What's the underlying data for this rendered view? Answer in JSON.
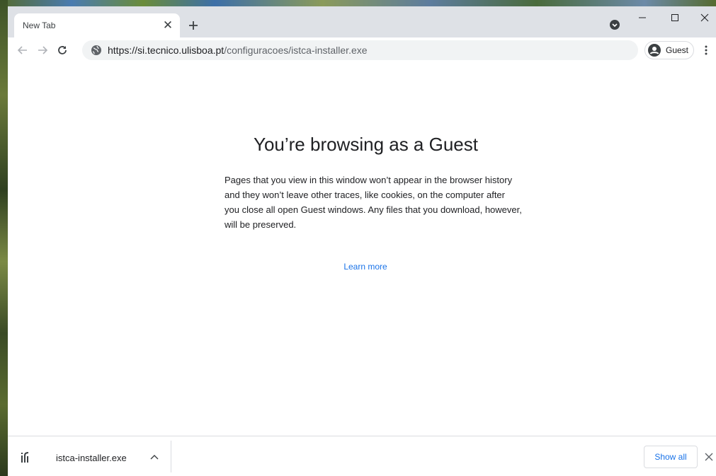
{
  "tab": {
    "title": "New Tab"
  },
  "toolbar": {
    "url_host": "https://si.tecnico.ulisboa.pt",
    "url_path": "/configuracoes/istca-installer.exe",
    "profile_label": "Guest"
  },
  "page": {
    "headline": "You’re browsing as a Guest",
    "body": "Pages that you view in this window won’t appear in the browser history and they won’t leave other traces, like cookies, on the computer after you close all open Guest windows. Any files that you download, however, will be preserved.",
    "learn_more": "Learn more"
  },
  "downloads": {
    "file_name": "istca-installer.exe",
    "show_all_label": "Show all"
  },
  "icons": {
    "tab_close": "close-icon",
    "new_tab": "plus-icon",
    "tab_search": "tab-search-icon",
    "minimize": "minimize-icon",
    "maximize": "maximize-icon",
    "window_close": "close-icon",
    "back": "arrow-left-icon",
    "forward": "arrow-right-icon",
    "reload": "reload-icon",
    "site_info": "globe-icon",
    "avatar": "account-circle-icon",
    "menu": "more-vertical-icon",
    "file": "file-icon",
    "chevron": "chevron-up-icon",
    "shelf_close": "close-icon"
  },
  "colors": {
    "titlebar": "#dee1e6",
    "omnibox": "#f1f3f4",
    "link": "#1a73e8",
    "text": "#202124",
    "muted_text": "#5f6368"
  }
}
